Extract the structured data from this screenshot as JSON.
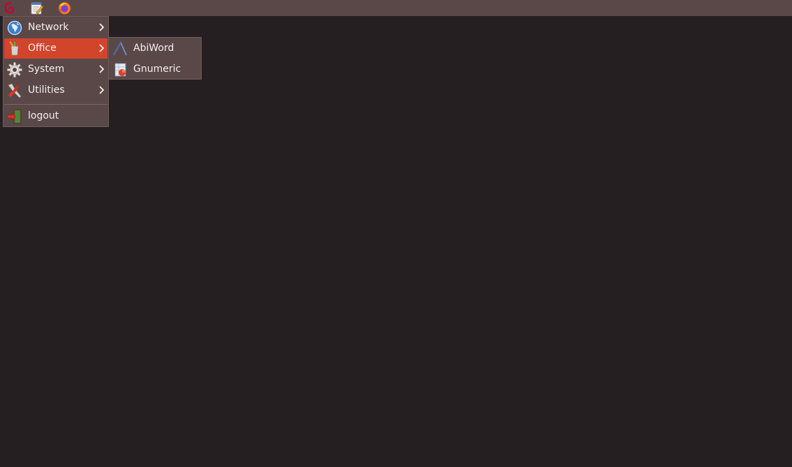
{
  "taskbar": {
    "icons": [
      "debian-logo-icon",
      "text-editor-icon",
      "firefox-icon"
    ]
  },
  "main_menu": {
    "items": [
      {
        "label": "Network",
        "icon": "network-globe-icon"
      },
      {
        "label": "Office",
        "icon": "office-icon"
      },
      {
        "label": "System",
        "icon": "gear-icon"
      },
      {
        "label": "Utilities",
        "icon": "utilities-icon"
      },
      {
        "label": "logout",
        "icon": "logout-icon"
      }
    ]
  },
  "office_submenu": {
    "items": [
      {
        "label": "AbiWord",
        "icon": "abiword-icon"
      },
      {
        "label": "Gnumeric",
        "icon": "gnumeric-icon"
      }
    ]
  },
  "colors": {
    "taskbar": "#5a4848",
    "desktop": "#261f21",
    "menu_bg": "#5a4848",
    "highlight": "#d2452a",
    "text": "#f3eeee"
  }
}
